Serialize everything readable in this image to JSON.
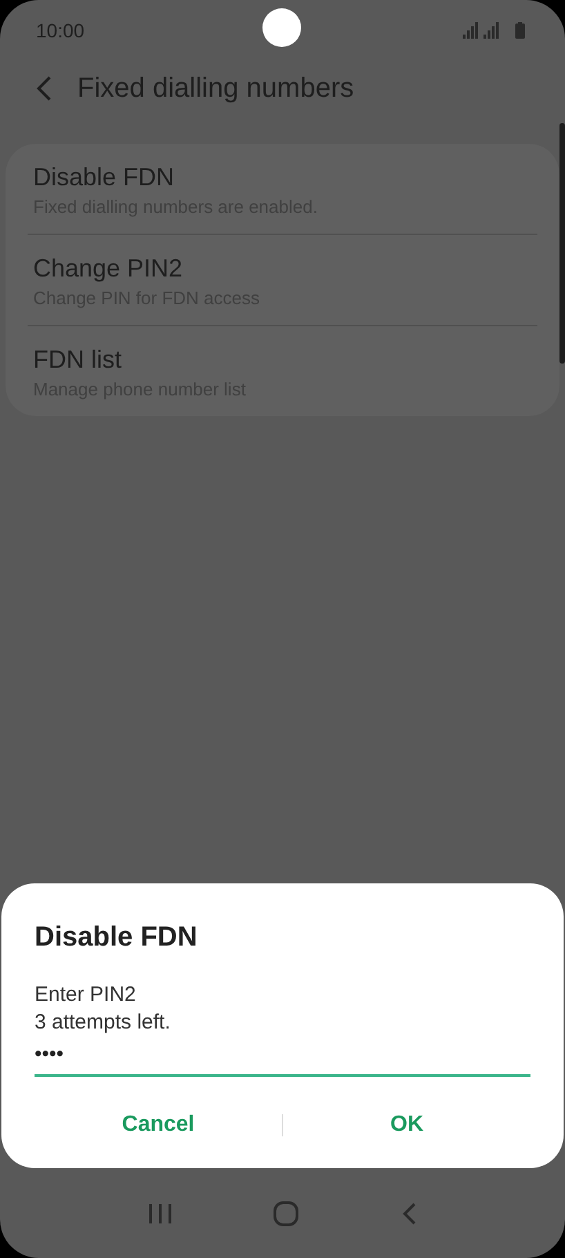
{
  "status_bar": {
    "time": "10:00"
  },
  "header": {
    "title": "Fixed dialling numbers"
  },
  "settings": [
    {
      "title": "Disable FDN",
      "subtitle": "Fixed dialling numbers are enabled."
    },
    {
      "title": "Change PIN2",
      "subtitle": "Change PIN for FDN access"
    },
    {
      "title": "FDN list",
      "subtitle": "Manage phone number list"
    }
  ],
  "dialog": {
    "title": "Disable FDN",
    "message": "Enter PIN2",
    "hint": "3 attempts left.",
    "value": "••••",
    "buttons": [
      "Cancel",
      "OK"
    ]
  }
}
